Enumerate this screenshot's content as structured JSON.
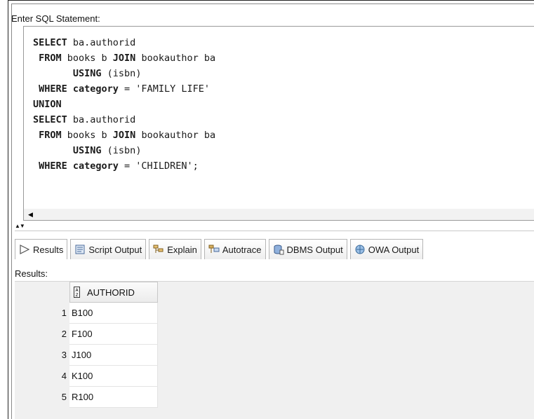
{
  "sql_panel": {
    "label": "Enter SQL Statement:",
    "lines": [
      [
        {
          "t": "SELECT",
          "kw": true
        },
        {
          "t": " ba.authorid",
          "kw": false
        }
      ],
      [
        {
          "t": " FROM",
          "kw": true
        },
        {
          "t": " books b ",
          "kw": false
        },
        {
          "t": "JOIN",
          "kw": true
        },
        {
          "t": " bookauthor ba",
          "kw": false
        }
      ],
      [
        {
          "t": "       USING",
          "kw": true
        },
        {
          "t": " (isbn)",
          "kw": false
        }
      ],
      [
        {
          "t": " WHERE category",
          "kw": true
        },
        {
          "t": " = 'FAMILY LIFE'",
          "kw": false
        }
      ],
      [
        {
          "t": "UNION",
          "kw": true
        }
      ],
      [
        {
          "t": "SELECT",
          "kw": true
        },
        {
          "t": " ba.authorid",
          "kw": false
        }
      ],
      [
        {
          "t": " FROM",
          "kw": true
        },
        {
          "t": " books b ",
          "kw": false
        },
        {
          "t": "JOIN",
          "kw": true
        },
        {
          "t": " bookauthor ba",
          "kw": false
        }
      ],
      [
        {
          "t": "       USING",
          "kw": true
        },
        {
          "t": " (isbn)",
          "kw": false
        }
      ],
      [
        {
          "t": " WHERE category",
          "kw": true
        },
        {
          "t": " = 'CHILDREN';",
          "kw": false
        }
      ]
    ]
  },
  "tabs": [
    {
      "label": "Results",
      "icon": "play-arrow-icon",
      "active": true
    },
    {
      "label": "Script Output",
      "icon": "script-output-icon",
      "active": false
    },
    {
      "label": "Explain",
      "icon": "explain-plan-icon",
      "active": false
    },
    {
      "label": "Autotrace",
      "icon": "autotrace-icon",
      "active": false
    },
    {
      "label": "DBMS Output",
      "icon": "dbms-output-icon",
      "active": false
    },
    {
      "label": "OWA Output",
      "icon": "owa-output-icon",
      "active": false
    }
  ],
  "results": {
    "label": "Results:",
    "column": "AUTHORID",
    "column_icon": "sort-az-icon",
    "rows": [
      {
        "num": "1",
        "value": "B100"
      },
      {
        "num": "2",
        "value": "F100"
      },
      {
        "num": "3",
        "value": "J100"
      },
      {
        "num": "4",
        "value": "K100"
      },
      {
        "num": "5",
        "value": "R100"
      }
    ]
  }
}
